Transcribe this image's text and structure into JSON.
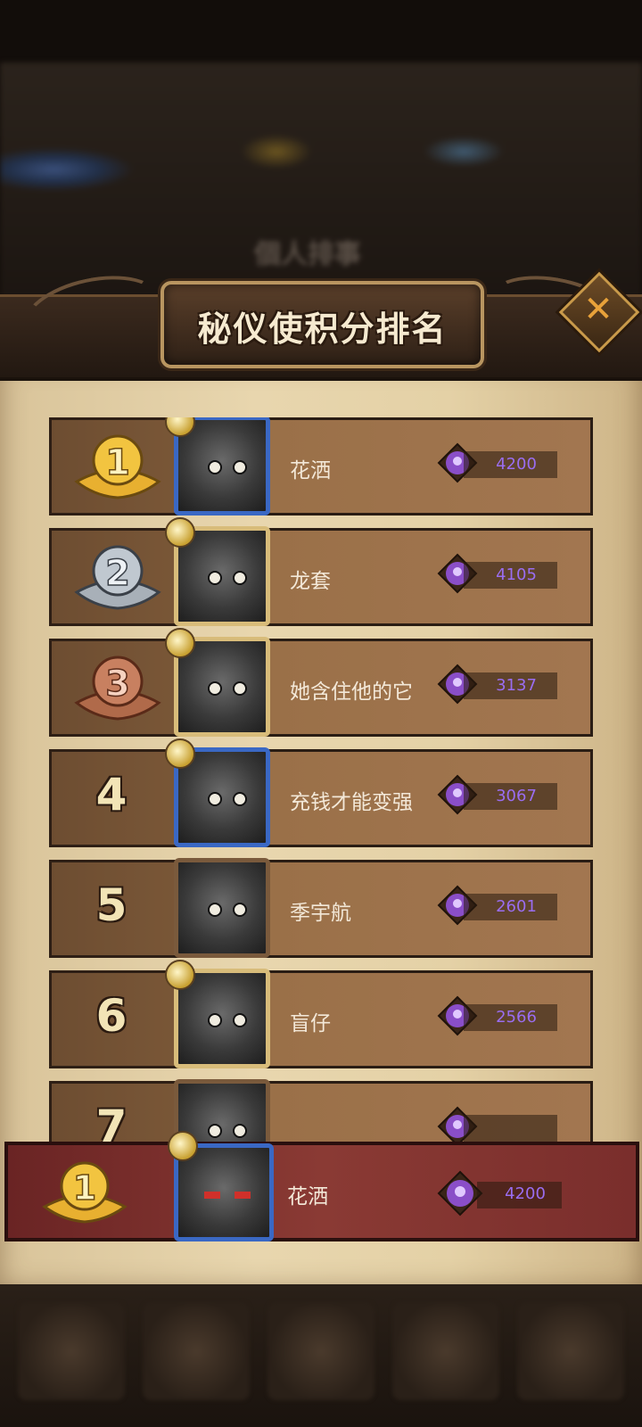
{
  "header": {
    "title": "秘仪使积分排名"
  },
  "background": {
    "blurred_title": "個人排事"
  },
  "rankings": [
    {
      "rank": "1",
      "name": "花洒",
      "score": "4200",
      "frame": "blue"
    },
    {
      "rank": "2",
      "name": "龙套",
      "score": "4105",
      "frame": "gold"
    },
    {
      "rank": "3",
      "name": "她含住他的它",
      "score": "3137",
      "frame": "gold"
    },
    {
      "rank": "4",
      "name": "充钱才能变强",
      "score": "3067",
      "frame": "blue"
    },
    {
      "rank": "5",
      "name": "季宇航",
      "score": "2601",
      "frame": "bronze"
    },
    {
      "rank": "6",
      "name": "盲仔",
      "score": "2566",
      "frame": "gold"
    },
    {
      "rank": "7",
      "name": "",
      "score": "",
      "frame": "bronze"
    }
  ],
  "my_rank": {
    "rank": "1",
    "name": "花洒",
    "score": "4200"
  },
  "colors": {
    "score_text": "#9a6df0",
    "gold_medal": "#e8b030",
    "silver_medal": "#c0c8d0",
    "bronze_medal": "#c88060",
    "my_bar": "#8a3a34"
  },
  "icons": [
    "close-icon",
    "score-gem-icon",
    "gold-medal-icon",
    "silver-medal-icon",
    "bronze-medal-icon"
  ]
}
